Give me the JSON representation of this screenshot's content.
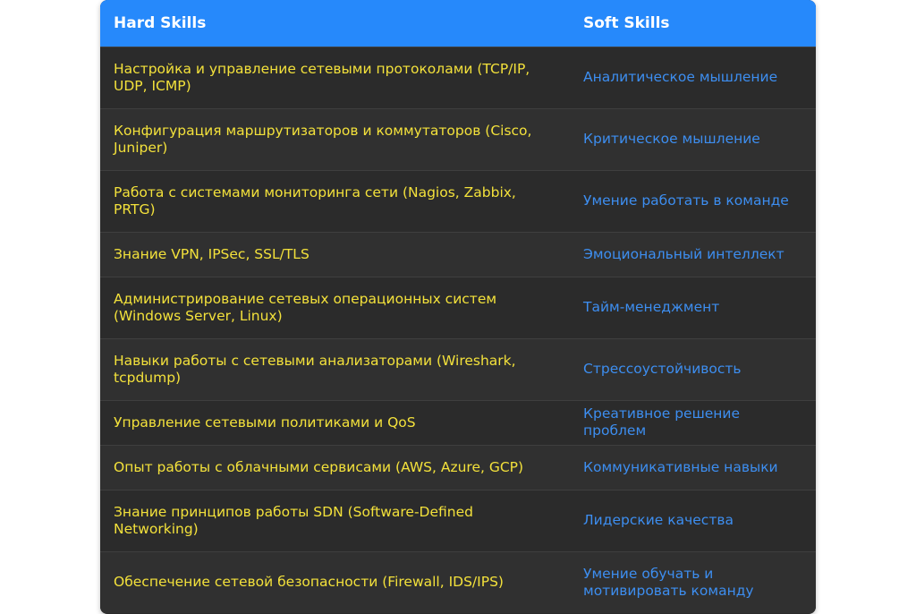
{
  "header": {
    "hard_label": "Hard Skills",
    "soft_label": "Soft Skills"
  },
  "rows": [
    {
      "hard": "Настройка и управление сетевыми протоколами (TCP/IP, UDP, ICMP)",
      "soft": "Аналитическое мышление"
    },
    {
      "hard": "Конфигурация маршрутизаторов и коммутаторов (Cisco, Juniper)",
      "soft": "Критическое мышление"
    },
    {
      "hard": "Работа с системами мониторинга сети (Nagios, Zabbix, PRTG)",
      "soft": "Умение работать в команде"
    },
    {
      "hard": "Знание VPN, IPSec, SSL/TLS",
      "soft": "Эмоциональный интеллект"
    },
    {
      "hard": "Администрирование сетевых операционных систем (Windows Server, Linux)",
      "soft": "Тайм-менеджмент"
    },
    {
      "hard": "Навыки работы с сетевыми анализаторами (Wireshark, tcpdump)",
      "soft": "Стрессоустойчивость"
    },
    {
      "hard": "Управление сетевыми политиками и QoS",
      "soft": "Креативное решение проблем"
    },
    {
      "hard": "Опыт работы с облачными сервисами (AWS, Azure, GCP)",
      "soft": "Коммуникативные навыки"
    },
    {
      "hard": "Знание принципов работы SDN (Software-Defined Networking)",
      "soft": "Лидерские качества"
    },
    {
      "hard": "Обеспечение сетевой безопасности (Firewall, IDS/IPS)",
      "soft": "Умение обучать и мотивировать команду"
    }
  ],
  "colors": {
    "header_bg": "#2689fb",
    "hard_text": "#f3e13b",
    "soft_text": "#3d8ef0",
    "row_bg": "#2b2b2b"
  }
}
